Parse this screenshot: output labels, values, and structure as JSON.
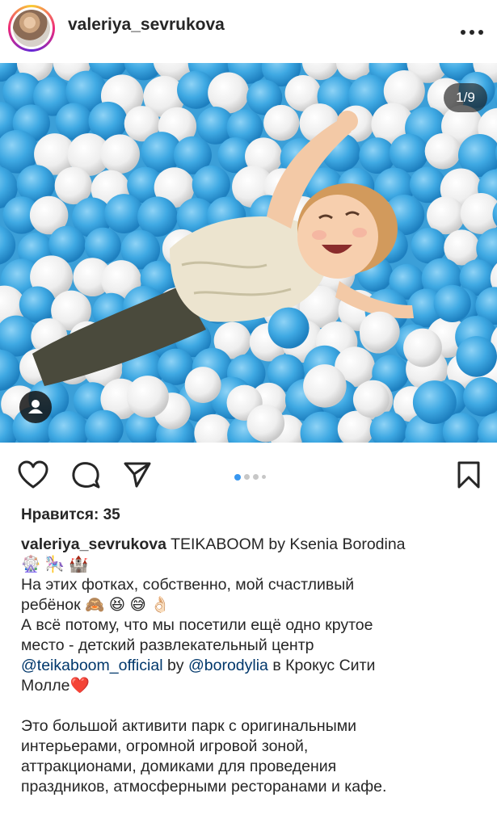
{
  "post": {
    "username": "valeriya_sevrukova",
    "image_counter": "1/9",
    "likes_text": "Нравится: 35",
    "caption": {
      "username": "valeriya_sevrukova",
      "line1": "TEIKABOOM by Ksenia Borodina",
      "line2_emoji": "🎡 🎠 🏰",
      "line3": "На этих фотках, собственно, мой счастливый",
      "line4": "ребёнок 🙈 😆 😅 👌🏻",
      "line5": "А всё потому, что мы посетили ещё одно крутое",
      "line6": "место - детский развлекательный центр",
      "mention1": "@teikaboom_official",
      "by_text": " by ",
      "mention2": "@borodylia",
      "line7_tail": "  в Крокус Сити",
      "line8": "Молле❤️",
      "para2_line1": "Это большой активити парк с оригинальными",
      "para2_line2": "интерьерами, огромной игровой зоной,",
      "para2_line3": "аттракционами, домиками для проведения",
      "para2_line4": "праздников, атмосферными ресторанами и кафе."
    }
  },
  "icons": {
    "more": "more-icon",
    "like": "heart-icon",
    "comment": "comment-icon",
    "share": "share-icon",
    "save": "bookmark-icon",
    "tag": "user-tag-icon"
  },
  "carousel": {
    "total_dots": 4,
    "active_index": 0
  },
  "colors": {
    "accent": "#3897f0",
    "mention": "#00376b",
    "ball_blue": "#3fa9e3",
    "ball_white": "#f3f3f3"
  }
}
